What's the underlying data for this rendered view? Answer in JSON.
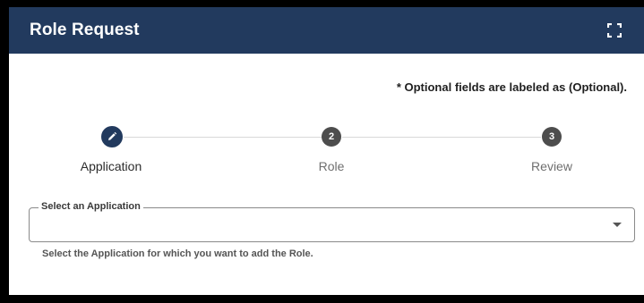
{
  "dialog": {
    "title": "Role Request",
    "expand_icon": "fullscreen-icon"
  },
  "optional_note": "* Optional fields are labeled as (Optional).",
  "stepper": {
    "steps": [
      {
        "number": "",
        "label": "Application",
        "icon": "pencil-icon",
        "active": true
      },
      {
        "number": "2",
        "label": "Role",
        "active": false
      },
      {
        "number": "3",
        "label": "Review",
        "active": false
      }
    ]
  },
  "application_select": {
    "legend": "Select an Application",
    "value": "",
    "helper_text": "Select the Application for which you want to add the Role."
  },
  "colors": {
    "header_bg": "#223a5e",
    "active_step": "#223a5e",
    "inactive_step": "#4d4d4d"
  }
}
